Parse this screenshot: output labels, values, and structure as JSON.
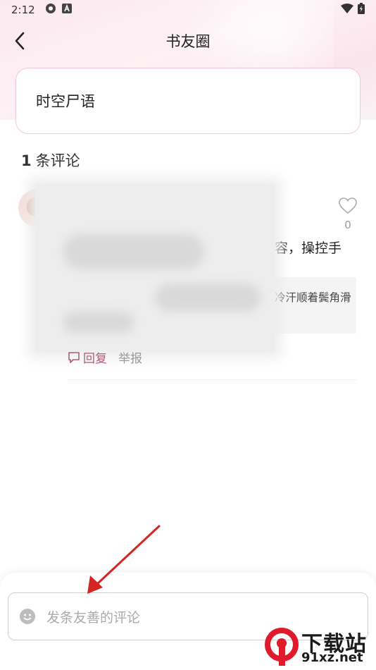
{
  "status_bar": {
    "time": "2:12"
  },
  "header": {
    "title": "书友圈"
  },
  "post": {
    "title": "时空尸语"
  },
  "comments": {
    "count": "1",
    "count_label": "条评论",
    "items": [
      {
        "likes": "0",
        "text_visible": "容，操控手",
        "quote_visible": "冷汗顺着鬓角滑"
      }
    ],
    "reply_label": "回复",
    "report_label": "举报"
  },
  "input": {
    "placeholder": "发条友善的评论"
  },
  "watermark": {
    "line1": "下载站",
    "line2": "91xz.net"
  },
  "colors": {
    "accent": "#b05b76",
    "card_border": "#f3c9d6",
    "arrow": "#d42424",
    "watermark_red": "#e0192b"
  }
}
